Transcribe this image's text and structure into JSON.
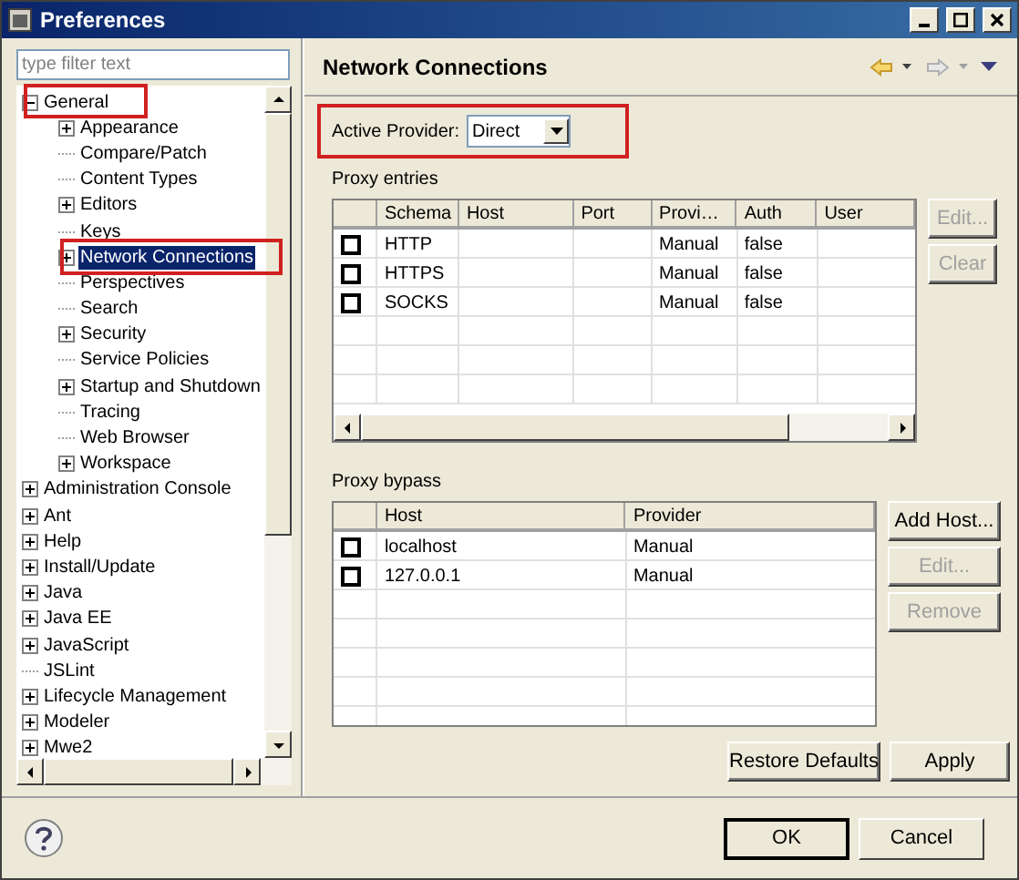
{
  "window": {
    "title": "Preferences"
  },
  "filter": {
    "placeholder": "type filter text"
  },
  "tree": [
    {
      "label": "General",
      "expanded": true,
      "selected": false,
      "children": [
        {
          "label": "Appearance",
          "expanded": false,
          "selected": false
        },
        {
          "label": "Compare/Patch",
          "selected": false
        },
        {
          "label": "Content Types",
          "selected": false
        },
        {
          "label": "Editors",
          "expanded": false,
          "selected": false
        },
        {
          "label": "Keys",
          "selected": false
        },
        {
          "label": "Network Connections",
          "expanded": false,
          "selected": true
        },
        {
          "label": "Perspectives",
          "selected": false
        },
        {
          "label": "Search",
          "selected": false
        },
        {
          "label": "Security",
          "expanded": false,
          "selected": false
        },
        {
          "label": "Service Policies",
          "selected": false
        },
        {
          "label": "Startup and Shutdown",
          "expanded": false,
          "selected": false
        },
        {
          "label": "Tracing",
          "selected": false
        },
        {
          "label": "Web Browser",
          "selected": false
        },
        {
          "label": "Workspace",
          "expanded": false,
          "selected": false
        }
      ]
    },
    {
      "label": "Administration Console",
      "expanded": false,
      "selected": false
    },
    {
      "label": "Ant",
      "expanded": false,
      "selected": false
    },
    {
      "label": "Help",
      "expanded": false,
      "selected": false
    },
    {
      "label": "Install/Update",
      "expanded": false,
      "selected": false
    },
    {
      "label": "Java",
      "expanded": false,
      "selected": false
    },
    {
      "label": "Java EE",
      "expanded": false,
      "selected": false
    },
    {
      "label": "JavaScript",
      "expanded": false,
      "selected": false
    },
    {
      "label": "JSLint",
      "selected": false
    },
    {
      "label": "Lifecycle Management",
      "expanded": false,
      "selected": false
    },
    {
      "label": "Modeler",
      "expanded": false,
      "selected": false
    },
    {
      "label": "Mwe2",
      "expanded": false,
      "selected": false
    }
  ],
  "page": {
    "title": "Network Connections",
    "active_provider": {
      "label": "Active Provider:",
      "value": "Direct"
    },
    "proxy_entries": {
      "label": "Proxy entries",
      "columns": [
        "Schema",
        "Host",
        "Port",
        "Provi…",
        "Auth",
        "User"
      ],
      "rows": [
        {
          "checked": false,
          "schema": "HTTP",
          "provider": "Manual",
          "auth": "false"
        },
        {
          "checked": false,
          "schema": "HTTPS",
          "provider": "Manual",
          "auth": "false"
        },
        {
          "checked": false,
          "schema": "SOCKS",
          "provider": "Manual",
          "auth": "false"
        }
      ],
      "buttons": [
        {
          "label": "Edit...",
          "disabled": true
        },
        {
          "label": "Clear",
          "disabled": true
        }
      ]
    },
    "proxy_bypass": {
      "label": "Proxy bypass",
      "columns": [
        "Host",
        "Provider"
      ],
      "rows": [
        {
          "checked": false,
          "host": "localhost",
          "provider": "Manual"
        },
        {
          "checked": false,
          "host": "127.0.0.1",
          "provider": "Manual"
        }
      ],
      "buttons": [
        {
          "label": "Add Host...",
          "disabled": false
        },
        {
          "label": "Edit...",
          "disabled": true
        },
        {
          "label": "Remove",
          "disabled": true
        }
      ]
    },
    "buttons": [
      "Restore Defaults",
      "Apply"
    ]
  },
  "dialog_buttons": [
    "OK",
    "Cancel"
  ]
}
